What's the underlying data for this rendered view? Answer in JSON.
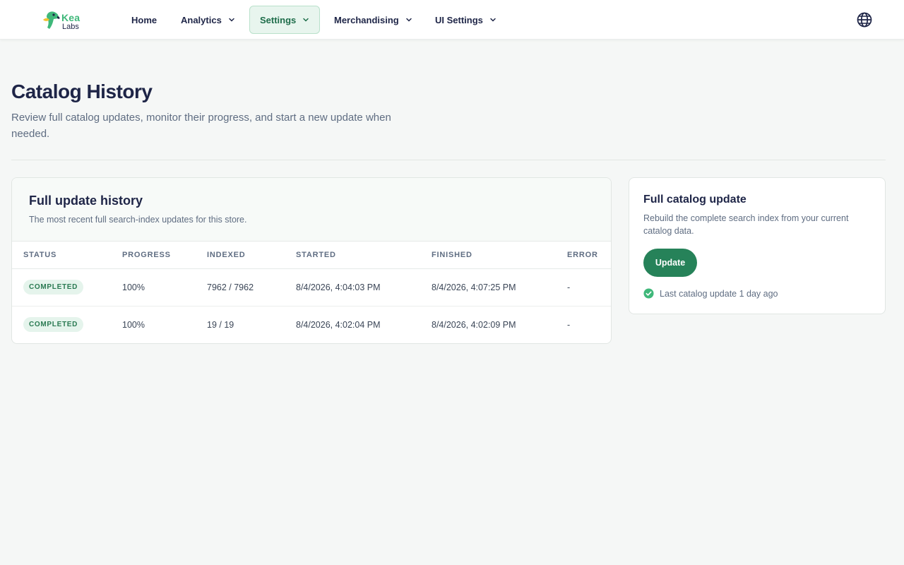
{
  "brand": {
    "name_line1": "Kea",
    "name_line2": "Labs"
  },
  "nav": {
    "items": [
      {
        "label": "Home",
        "has_dropdown": false,
        "active": false
      },
      {
        "label": "Analytics",
        "has_dropdown": true,
        "active": false
      },
      {
        "label": "Settings",
        "has_dropdown": true,
        "active": true
      },
      {
        "label": "Merchandising",
        "has_dropdown": true,
        "active": false
      },
      {
        "label": "UI Settings",
        "has_dropdown": true,
        "active": false
      }
    ],
    "language_icon": "globe-icon"
  },
  "page": {
    "title": "Catalog History",
    "subtitle": "Review full catalog updates, monitor their progress, and start a new update when needed."
  },
  "history": {
    "title": "Full update history",
    "subtitle": "The most recent full search-index updates for this store.",
    "columns": [
      "STATUS",
      "PROGRESS",
      "INDEXED",
      "STARTED",
      "FINISHED",
      "ERROR"
    ],
    "rows": [
      {
        "status": "COMPLETED",
        "progress": "100%",
        "indexed": "7962 / 7962",
        "started": "8/4/2026, 4:04:03 PM",
        "finished": "8/4/2026, 4:07:25 PM",
        "error": "-"
      },
      {
        "status": "COMPLETED",
        "progress": "100%",
        "indexed": "19 / 19",
        "started": "8/4/2026, 4:02:04 PM",
        "finished": "8/4/2026, 4:02:09 PM",
        "error": "-"
      }
    ]
  },
  "update_panel": {
    "title": "Full catalog update",
    "description": "Rebuild the complete search index from your current catalog data.",
    "button_label": "Update",
    "last_update": "Last catalog update 1 day ago"
  },
  "colors": {
    "accent": "#268259",
    "brand_green": "#3fb87a",
    "brand_yellow": "#f2c230",
    "text_dark": "#1e2547",
    "background": "#f5f7f6"
  }
}
